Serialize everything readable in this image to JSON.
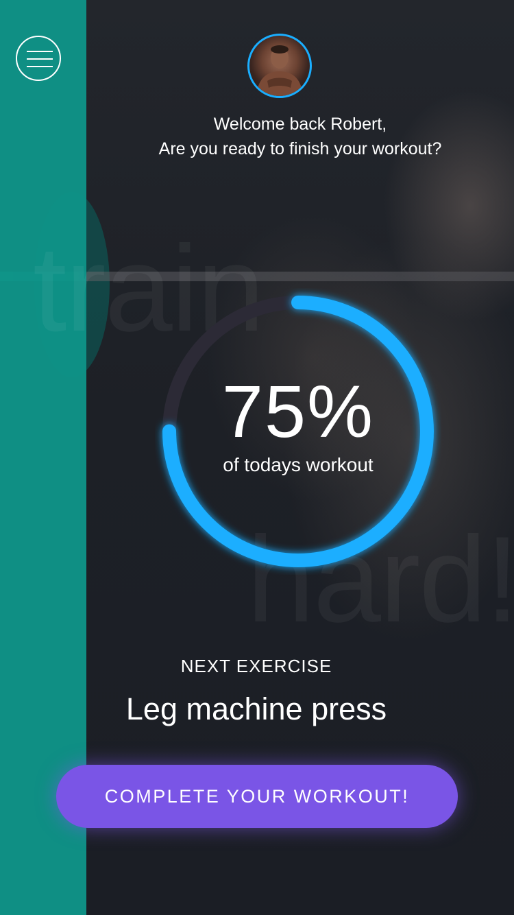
{
  "header": {
    "menu_icon": "hamburger-menu-icon",
    "avatar_alt": "user-avatar"
  },
  "welcome": {
    "line1": "Welcome back Robert,",
    "line2": "Are you ready to finish your workout?"
  },
  "background": {
    "watermark_top": "train",
    "watermark_bottom": "hard!"
  },
  "progress": {
    "value": 0.75,
    "percent_text": "75%",
    "label": "of todays workout",
    "ring_color": "#1aaeff",
    "track_color": "#2c2a36"
  },
  "next_exercise": {
    "label": "NEXT EXERCISE",
    "name": "Leg machine press"
  },
  "cta": {
    "label": "COMPLETE YOUR WORKOUT!",
    "color": "#7a55e6"
  },
  "colors": {
    "sidebar": "#0f9488",
    "background": "#1c1f26"
  }
}
